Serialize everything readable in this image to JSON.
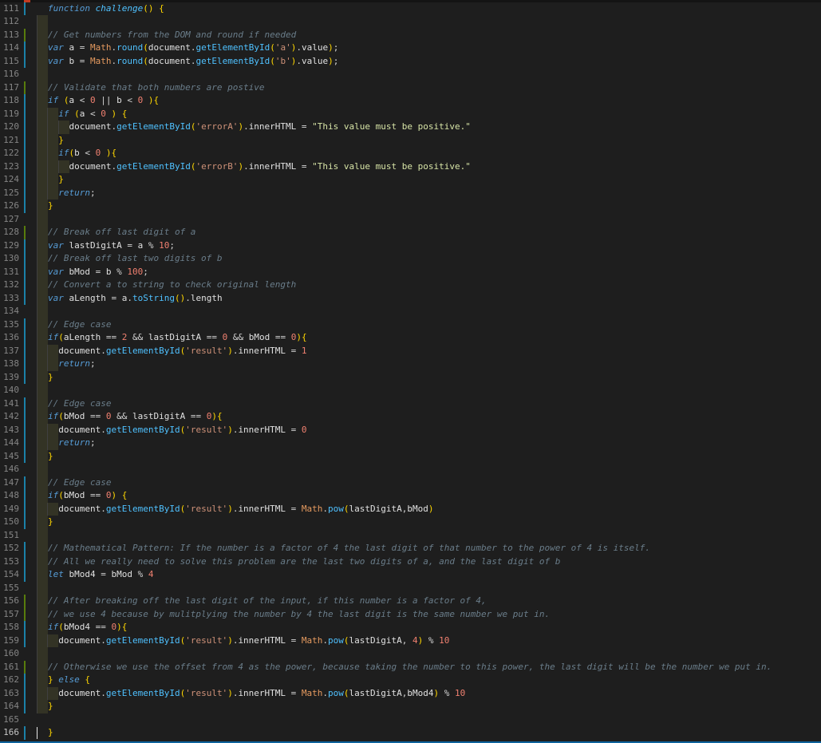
{
  "editor": {
    "language": "javascript",
    "lines": [
      {
        "n": "111",
        "text": "function challenge() {",
        "indent": 0,
        "git": "m"
      },
      {
        "n": "112",
        "text": "",
        "indent": 1,
        "git": ""
      },
      {
        "n": "113",
        "text": "// Get numbers from the DOM and round if needed",
        "indent": 1,
        "git": "a"
      },
      {
        "n": "114",
        "text": "var a = Math.round(document.getElementById('a').value);",
        "indent": 1,
        "git": "m"
      },
      {
        "n": "115",
        "text": "var b = Math.round(document.getElementById('b').value);",
        "indent": 1,
        "git": "m"
      },
      {
        "n": "116",
        "text": "",
        "indent": 1,
        "git": ""
      },
      {
        "n": "117",
        "text": "// Validate that both numbers are postive",
        "indent": 1,
        "git": "a"
      },
      {
        "n": "118",
        "text": "if (a < 0 || b < 0 ){",
        "indent": 1,
        "git": "m"
      },
      {
        "n": "119",
        "text": "if (a < 0 ) {",
        "indent": 2,
        "git": "m"
      },
      {
        "n": "120",
        "text": "document.getElementById('errorA').innerHTML = \"This value must be positive.\"",
        "indent": 3,
        "git": "m"
      },
      {
        "n": "121",
        "text": "}",
        "indent": 2,
        "git": "m"
      },
      {
        "n": "122",
        "text": "if(b < 0 ){",
        "indent": 2,
        "git": "m"
      },
      {
        "n": "123",
        "text": "document.getElementById('errorB').innerHTML = \"This value must be positive.\"",
        "indent": 3,
        "git": "m"
      },
      {
        "n": "124",
        "text": "}",
        "indent": 2,
        "git": "m"
      },
      {
        "n": "125",
        "text": "return;",
        "indent": 2,
        "git": "m"
      },
      {
        "n": "126",
        "text": "}",
        "indent": 1,
        "git": "m"
      },
      {
        "n": "127",
        "text": "",
        "indent": 1,
        "git": ""
      },
      {
        "n": "128",
        "text": "// Break off last digit of a",
        "indent": 1,
        "git": "a"
      },
      {
        "n": "129",
        "text": "var lastDigitA = a % 10;",
        "indent": 1,
        "git": "m"
      },
      {
        "n": "130",
        "text": "// Break off last two digits of b",
        "indent": 1,
        "git": "m"
      },
      {
        "n": "131",
        "text": "var bMod = b % 100;",
        "indent": 1,
        "git": "m"
      },
      {
        "n": "132",
        "text": "// Convert a to string to check original length",
        "indent": 1,
        "git": "m"
      },
      {
        "n": "133",
        "text": "var aLength = a.toString().length",
        "indent": 1,
        "git": "m"
      },
      {
        "n": "134",
        "text": "",
        "indent": 1,
        "git": ""
      },
      {
        "n": "135",
        "text": "// Edge case",
        "indent": 1,
        "git": "m"
      },
      {
        "n": "136",
        "text": "if(aLength == 2 && lastDigitA == 0 && bMod == 0){",
        "indent": 1,
        "git": "m"
      },
      {
        "n": "137",
        "text": "document.getElementById('result').innerHTML = 1",
        "indent": 2,
        "git": "m"
      },
      {
        "n": "138",
        "text": "return;",
        "indent": 2,
        "git": "m"
      },
      {
        "n": "139",
        "text": "}",
        "indent": 1,
        "git": "m"
      },
      {
        "n": "140",
        "text": "",
        "indent": 1,
        "git": ""
      },
      {
        "n": "141",
        "text": "// Edge case",
        "indent": 1,
        "git": "m"
      },
      {
        "n": "142",
        "text": "if(bMod == 0 && lastDigitA == 0){",
        "indent": 1,
        "git": "m"
      },
      {
        "n": "143",
        "text": "document.getElementById('result').innerHTML = 0",
        "indent": 2,
        "git": "m"
      },
      {
        "n": "144",
        "text": "return;",
        "indent": 2,
        "git": "m"
      },
      {
        "n": "145",
        "text": "}",
        "indent": 1,
        "git": "m"
      },
      {
        "n": "146",
        "text": "",
        "indent": 1,
        "git": ""
      },
      {
        "n": "147",
        "text": "// Edge case",
        "indent": 1,
        "git": "m"
      },
      {
        "n": "148",
        "text": "if(bMod == 0) {",
        "indent": 1,
        "git": "m"
      },
      {
        "n": "149",
        "text": "document.getElementById('result').innerHTML = Math.pow(lastDigitA,bMod)",
        "indent": 2,
        "git": "m"
      },
      {
        "n": "150",
        "text": "}",
        "indent": 1,
        "git": "m"
      },
      {
        "n": "151",
        "text": "",
        "indent": 1,
        "git": ""
      },
      {
        "n": "152",
        "text": "// Mathematical Pattern: If the number is a factor of 4 the last digit of that number to the power of 4 is itself.",
        "indent": 1,
        "git": "m"
      },
      {
        "n": "153",
        "text": "// All we really need to solve this problem are the last two digits of a, and the last digit of b",
        "indent": 1,
        "git": "m"
      },
      {
        "n": "154",
        "text": "let bMod4 = bMod % 4",
        "indent": 1,
        "git": "m"
      },
      {
        "n": "155",
        "text": "",
        "indent": 1,
        "git": ""
      },
      {
        "n": "156",
        "text": "// After breaking off the last digit of the input, if this number is a factor of 4,",
        "indent": 1,
        "git": "a"
      },
      {
        "n": "157",
        "text": "// we use 4 because by mulitplying the number by 4 the last digit is the same number we put in.",
        "indent": 1,
        "git": "a"
      },
      {
        "n": "158",
        "text": "if(bMod4 == 0){",
        "indent": 1,
        "git": "m"
      },
      {
        "n": "159",
        "text": "document.getElementById('result').innerHTML = Math.pow(lastDigitA, 4) % 10",
        "indent": 2,
        "git": "m"
      },
      {
        "n": "160",
        "text": "",
        "indent": 1,
        "git": ""
      },
      {
        "n": "161",
        "text": "// Otherwise we use the offset from 4 as the power, because taking the number to this power, the last digit will be the number we put in.",
        "indent": 1,
        "git": "a"
      },
      {
        "n": "162",
        "text": "} else {",
        "indent": 1,
        "git": "m"
      },
      {
        "n": "163",
        "text": "document.getElementById('result').innerHTML = Math.pow(lastDigitA,bMod4) % 10",
        "indent": 2,
        "git": "m"
      },
      {
        "n": "164",
        "text": "}",
        "indent": 1,
        "git": "m"
      },
      {
        "n": "165",
        "text": "",
        "indent": 0,
        "git": ""
      },
      {
        "n": "166",
        "text": "}",
        "indent": 0,
        "git": "m",
        "active": true
      }
    ]
  },
  "colors": {
    "background": "#1e1e1e",
    "keyword": "#569cd6",
    "method": "#4fc1ff",
    "math": "#e59a5f",
    "string_single": "#ce9178",
    "string_double": "#d7e4a6",
    "number": "#f08070",
    "comment": "#6a7d8a",
    "git_modified": "#1b81a8",
    "git_added": "#587c0c"
  }
}
